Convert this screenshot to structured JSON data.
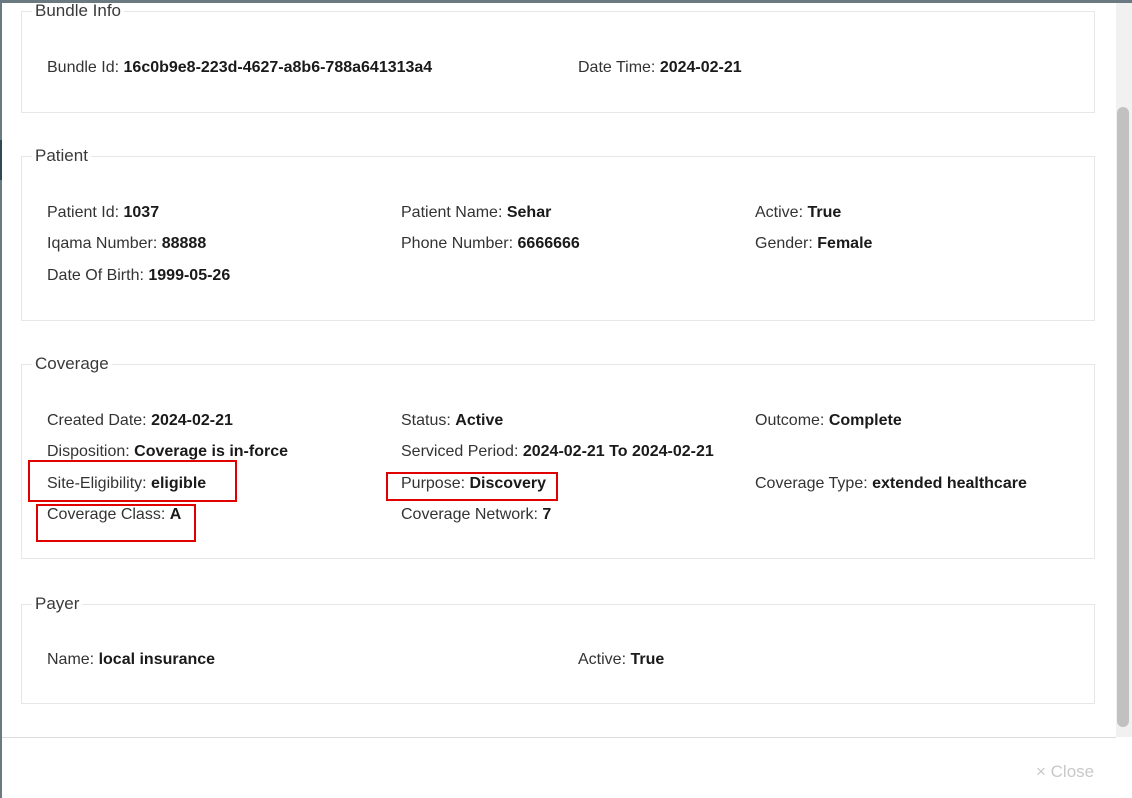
{
  "sections": {
    "bundle": {
      "legend": "Bundle Info",
      "fields": [
        {
          "label": "Bundle Id:",
          "value": "16c0b9e8-223d-4627-a8b6-788a641313a4"
        },
        {
          "label": "Date Time:",
          "value": "2024-02-21"
        }
      ]
    },
    "patient": {
      "legend": "Patient",
      "fields": [
        {
          "label": "Patient Id:",
          "value": "1037"
        },
        {
          "label": "Patient Name:",
          "value": "Sehar"
        },
        {
          "label": "Active:",
          "value": "True"
        },
        {
          "label": "Iqama Number:",
          "value": "88888"
        },
        {
          "label": "Phone Number:",
          "value": "6666666"
        },
        {
          "label": "Gender:",
          "value": "Female"
        },
        {
          "label": "Date Of Birth:",
          "value": "1999-05-26"
        }
      ]
    },
    "coverage": {
      "legend": "Coverage",
      "fields": [
        {
          "label": "Created Date:",
          "value": "2024-02-21"
        },
        {
          "label": "Status:",
          "value": "Active"
        },
        {
          "label": "Outcome:",
          "value": "Complete"
        },
        {
          "label": "Disposition:",
          "value": "Coverage is in-force"
        },
        {
          "label": "Serviced Period:",
          "value": "2024-02-21 To 2024-02-21"
        },
        {
          "label": "Site-Eligibility:",
          "value": "eligible"
        },
        {
          "label": "Purpose:",
          "value": "Discovery"
        },
        {
          "label": "Coverage Type:",
          "value": "extended healthcare"
        },
        {
          "label": "Coverage Class:",
          "value": "A"
        },
        {
          "label": "Coverage Network:",
          "value": "7"
        }
      ]
    },
    "payer": {
      "legend": "Payer",
      "fields": [
        {
          "label": "Name:",
          "value": "local insurance"
        },
        {
          "label": "Active:",
          "value": "True"
        }
      ]
    }
  },
  "footer": {
    "close_label": "× Close"
  },
  "colors": {
    "highlight": "#e00000",
    "backdrop": "#6b7a80"
  }
}
